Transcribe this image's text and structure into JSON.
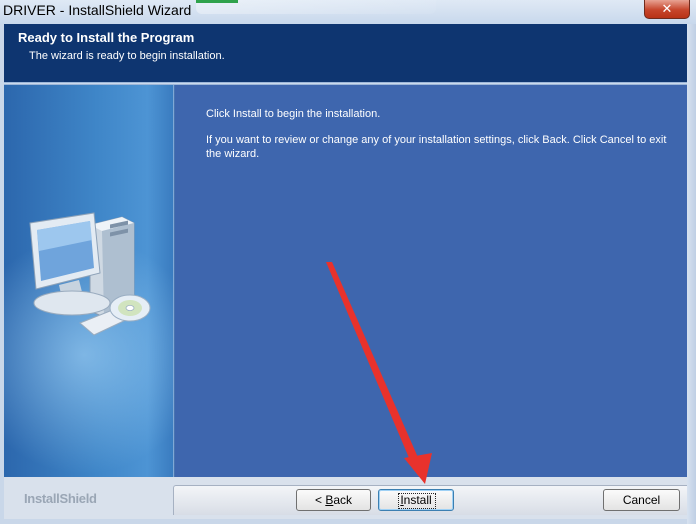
{
  "window": {
    "title": "DRIVER - InstallShield Wizard",
    "close_glyph": "✕"
  },
  "header": {
    "title": "Ready to Install the Program",
    "subtitle": "The wizard is ready to begin installation."
  },
  "main": {
    "line1": "Click Install to begin the installation.",
    "line2": "If you want to review or change any of your installation settings, click Back. Click Cancel to exit the wizard."
  },
  "footer": {
    "brand": "InstallShield",
    "buttons": {
      "back": {
        "prefix": "< ",
        "accel": "B",
        "rest": "ack"
      },
      "install": {
        "accel": "I",
        "rest": "nstall"
      },
      "cancel": "Cancel"
    }
  },
  "colors": {
    "header_bg": "#0e3570",
    "panel_bg": "#3e66ae",
    "annotation_arrow": "#e8322c"
  },
  "icons": [
    "computer-illustration-icon",
    "cd-disc-icon",
    "close-icon",
    "red-annotation-arrow"
  ]
}
